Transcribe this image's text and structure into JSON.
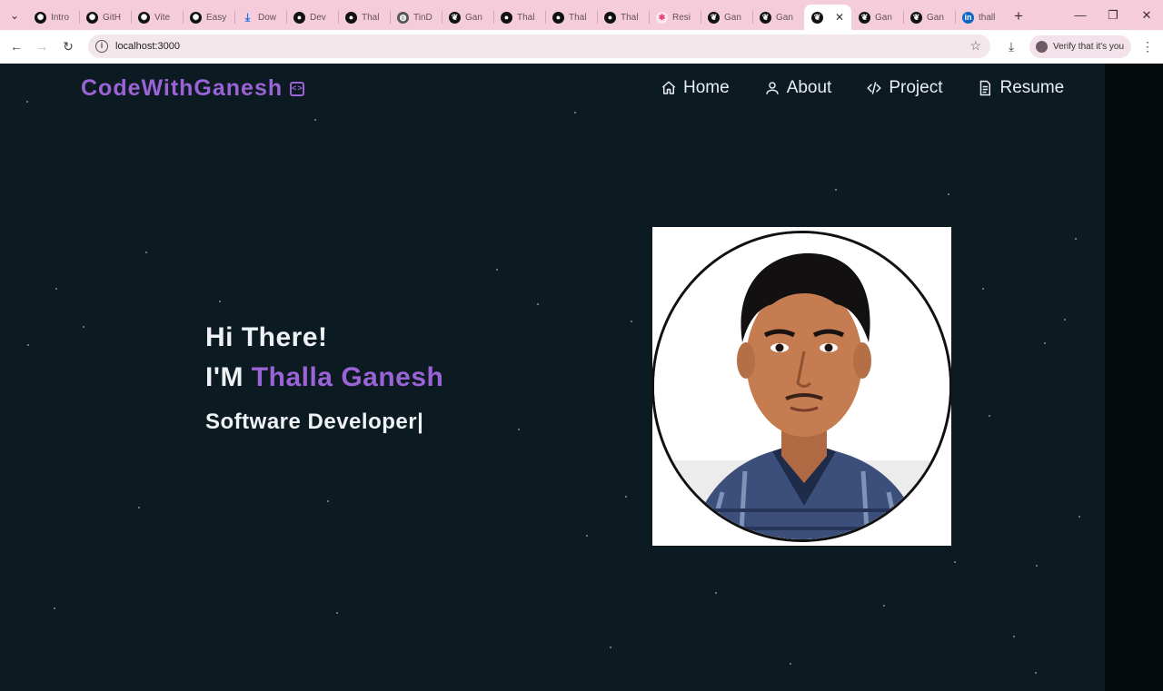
{
  "browser": {
    "tabs": [
      {
        "label": "Intro",
        "icon": "openai-icon",
        "color": "#111111"
      },
      {
        "label": "GitH",
        "icon": "openai-icon",
        "color": "#111111"
      },
      {
        "label": "Vite",
        "icon": "openai-icon",
        "color": "#111111"
      },
      {
        "label": "Easy",
        "icon": "openai-icon",
        "color": "#111111"
      },
      {
        "label": "Dow",
        "icon": "download-icon",
        "color": "#1a73e8"
      },
      {
        "label": "Dev",
        "icon": "github-icon",
        "color": "#111111"
      },
      {
        "label": "Thal",
        "icon": "github-icon",
        "color": "#111111"
      },
      {
        "label": "TinD",
        "icon": "globe-icon",
        "color": "#555555"
      },
      {
        "label": "Gan",
        "icon": "leaf-icon",
        "color": "#111111"
      },
      {
        "label": "Thal",
        "icon": "github-icon",
        "color": "#111111"
      },
      {
        "label": "Thal",
        "icon": "github-icon",
        "color": "#111111"
      },
      {
        "label": "Thal",
        "icon": "github-icon",
        "color": "#111111"
      },
      {
        "label": "Resi",
        "icon": "resume-icon",
        "color": "#e0457b"
      },
      {
        "label": "Gan",
        "icon": "leaf-icon",
        "color": "#111111"
      },
      {
        "label": "Gan",
        "icon": "leaf-icon",
        "color": "#111111"
      },
      {
        "label": "",
        "icon": "leaf-icon",
        "color": "#111111",
        "active": true
      },
      {
        "label": "Gan",
        "icon": "leaf-icon",
        "color": "#111111"
      },
      {
        "label": "Gan",
        "icon": "leaf-icon",
        "color": "#111111"
      },
      {
        "label": "thall",
        "icon": "linkedin-icon",
        "color": "#0a66c2"
      }
    ],
    "url": "localhost:3000",
    "verify_label": "Verify that it's you"
  },
  "site": {
    "brand": "CodeWithGanesh",
    "nav": [
      {
        "label": "Home",
        "icon": "home-icon"
      },
      {
        "label": "About",
        "icon": "user-icon"
      },
      {
        "label": "Project",
        "icon": "code-icon"
      },
      {
        "label": "Resume",
        "icon": "document-icon"
      }
    ],
    "hero": {
      "greeting": "Hi There!",
      "im_prefix": "I'M ",
      "name": "Thalla Ganesh",
      "role": "Software Developer|"
    },
    "accent_color": "#9a63d6"
  }
}
